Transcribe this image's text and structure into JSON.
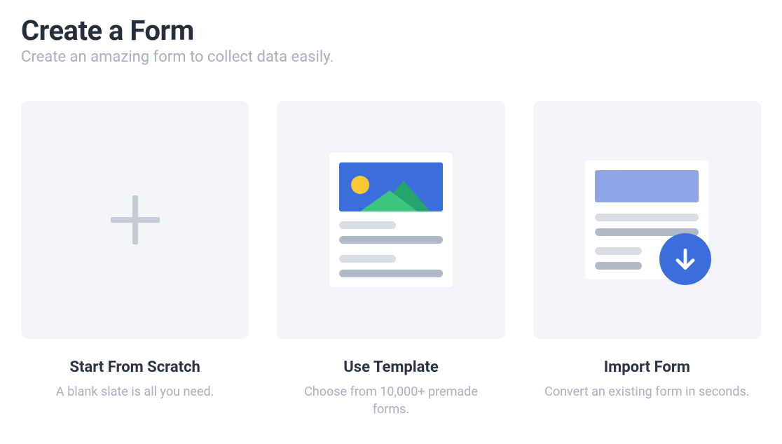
{
  "header": {
    "title": "Create a Form",
    "subtitle": "Create an amazing form to collect data easily."
  },
  "cards": {
    "scratch": {
      "title": "Start From Scratch",
      "desc": "A blank slate is all you need."
    },
    "template": {
      "title": "Use Template",
      "desc": "Choose from 10,000+ premade forms."
    },
    "import": {
      "title": "Import Form",
      "desc": "Convert an existing form in seconds."
    }
  }
}
